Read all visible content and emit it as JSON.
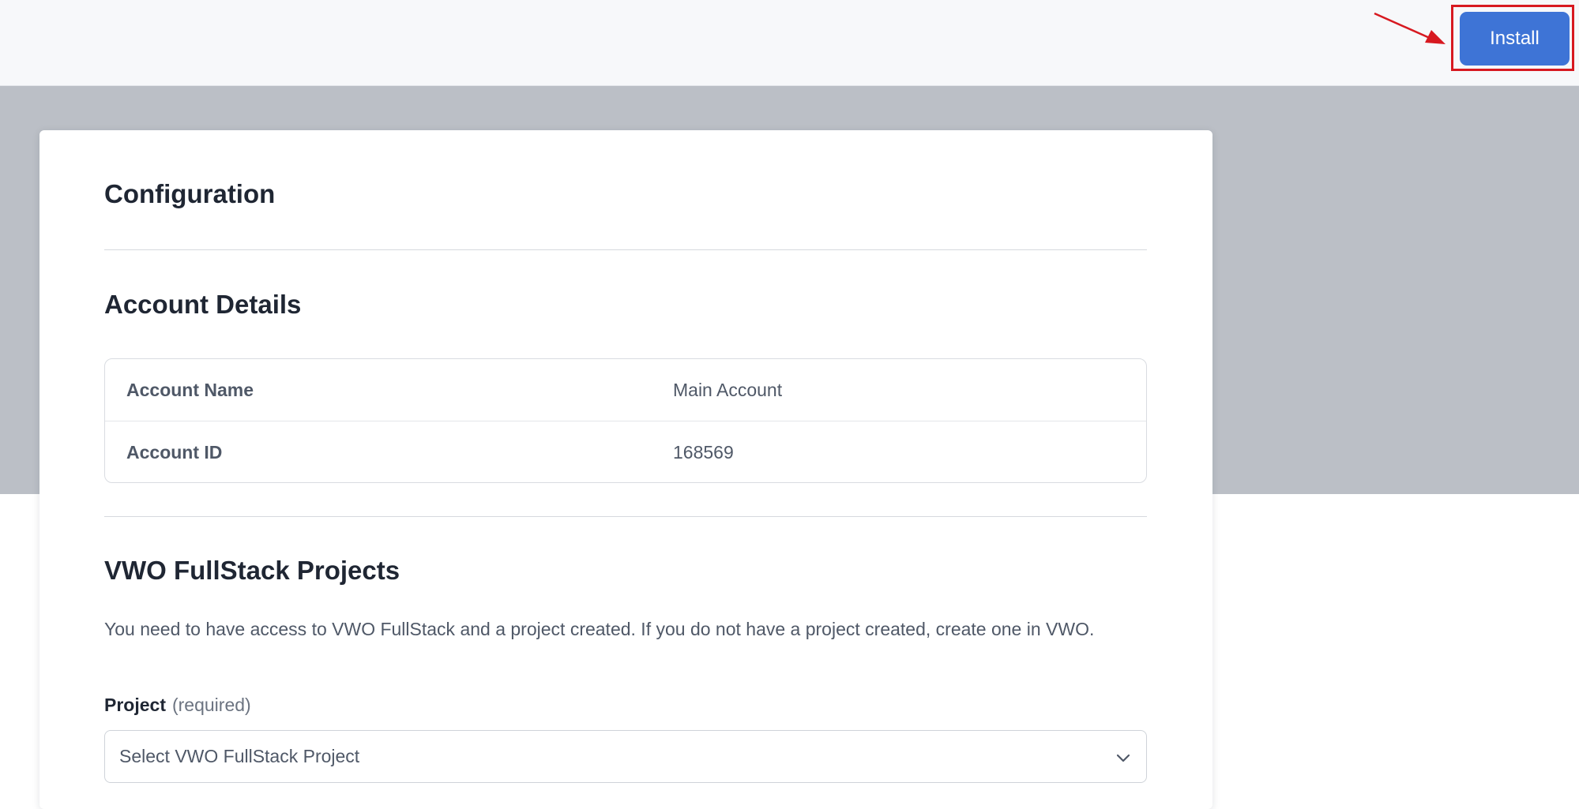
{
  "header": {
    "install_label": "Install"
  },
  "configuration": {
    "title": "Configuration"
  },
  "account_details": {
    "title": "Account Details",
    "rows": [
      {
        "key": "Account Name",
        "value": "Main Account"
      },
      {
        "key": "Account ID",
        "value": "168569"
      }
    ]
  },
  "projects": {
    "title": "VWO FullStack Projects",
    "description": "You need to have access to VWO FullStack and a project created. If you do not have a project created, create one in VWO.",
    "field_label": "Project",
    "field_hint": "(required)",
    "select_placeholder": "Select VWO FullStack Project"
  },
  "colors": {
    "accent": "#3e74d6",
    "annotation": "#d71920",
    "backdrop": "#bbbfc6"
  },
  "icons": {
    "select_chevron": "chevron-down-icon",
    "annotation_arrow": "arrow-icon"
  }
}
